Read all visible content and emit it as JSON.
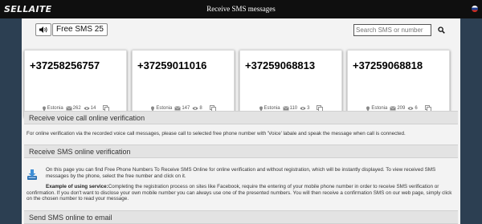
{
  "header": {
    "logo_text": "SELLAITE",
    "title": "Receive SMS messages",
    "flag_icon": "russia-flag-icon"
  },
  "toolbar": {
    "sound_icon": "speaker-icon",
    "free_sms_label": "Free SMS 25",
    "search_placeholder": "Search SMS or number",
    "search_icon": "search-icon"
  },
  "cards": [
    {
      "number": "+37258256757",
      "country": "Estonia",
      "sms_count": "262",
      "views": "14"
    },
    {
      "number": "+37259011016",
      "country": "Estonia",
      "sms_count": "147",
      "views": "8"
    },
    {
      "number": "+37259068813",
      "country": "Estonia",
      "sms_count": "110",
      "views": "3"
    },
    {
      "number": "+37259068818",
      "country": "Estonia",
      "sms_count": "209",
      "views": "6"
    }
  ],
  "voice_section": {
    "title": "Receive voice call online verification",
    "text": "For online verification via the recorded voice call messages, please call to selected free phone number with 'Voice' labale and speak the message when call is connected."
  },
  "sms_section": {
    "title": "Receive SMS online verification",
    "intro": "On this page you can find Free Phone Numbers To Receive SMS Online for online verification and without registration, which will be instantly displayed. To view received SMS messages by the phone, select the free number and click on it.",
    "example_label": "Example of using service:",
    "example_text": "Completing the registration process on sites like Facebook, require the entering of your mobile phone number in order to receive SMS verification or confirmation. If you don't want to disclose your own mobile number you can always use one of the presented numbers. You will then receive a confirmation SMS on our web page, simply click on the chosen number to read your message."
  },
  "send_section": {
    "title": "Send SMS online to email"
  }
}
